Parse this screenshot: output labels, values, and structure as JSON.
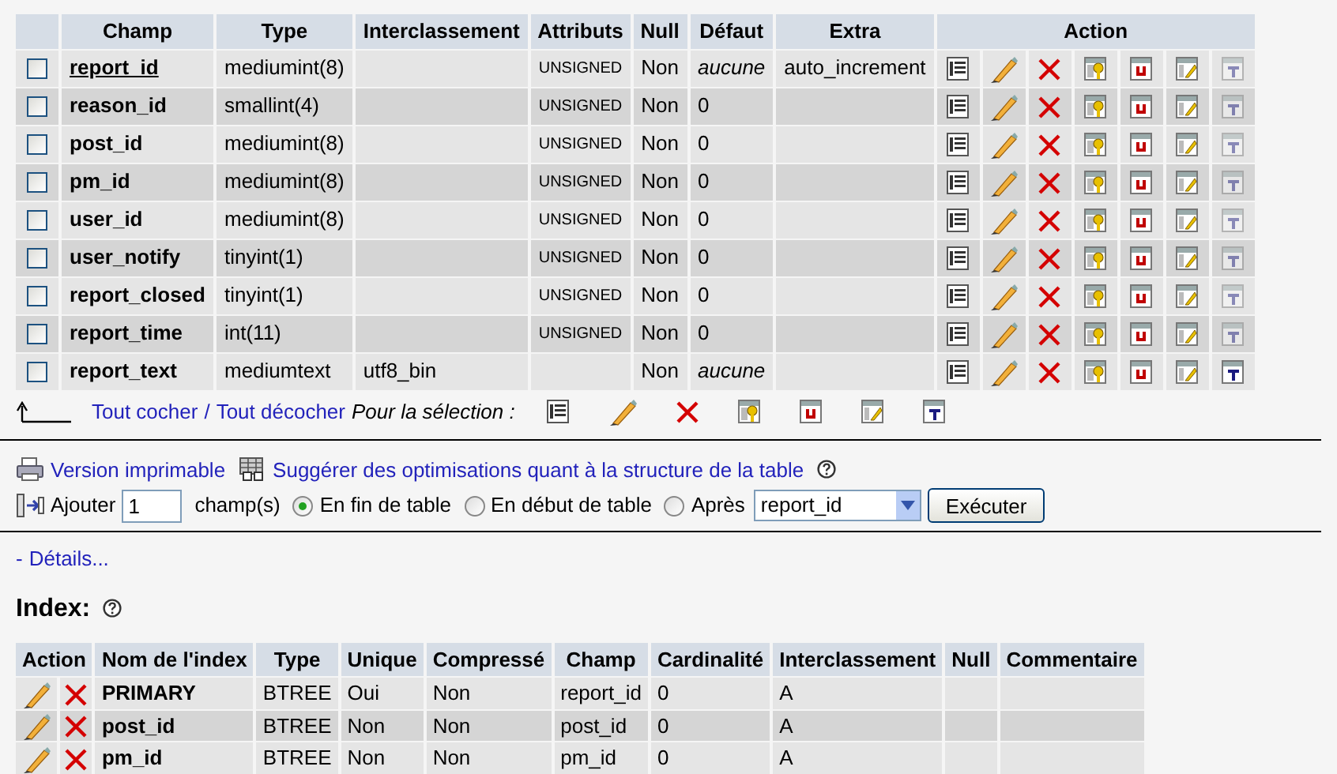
{
  "fields_table": {
    "columns": [
      "Champ",
      "Type",
      "Interclassement",
      "Attributs",
      "Null",
      "Défaut",
      "Extra",
      "Action"
    ],
    "rows": [
      {
        "checked": false,
        "name": "report_id",
        "primary": true,
        "type": "mediumint(8)",
        "attributes": "UNSIGNED",
        "null": "Non",
        "default": "aucune",
        "default_none": true,
        "extra": "auto_increment",
        "fulltext_available": false
      },
      {
        "checked": false,
        "name": "reason_id",
        "primary": false,
        "type": "smallint(4)",
        "attributes": "UNSIGNED",
        "null": "Non",
        "default": "0",
        "default_none": false,
        "fulltext_available": false
      },
      {
        "checked": false,
        "name": "post_id",
        "primary": false,
        "type": "mediumint(8)",
        "attributes": "UNSIGNED",
        "null": "Non",
        "default": "0",
        "default_none": false,
        "fulltext_available": false
      },
      {
        "checked": false,
        "name": "pm_id",
        "primary": false,
        "type": "mediumint(8)",
        "attributes": "UNSIGNED",
        "null": "Non",
        "default": "0",
        "default_none": false,
        "fulltext_available": false
      },
      {
        "checked": false,
        "name": "user_id",
        "primary": false,
        "type": "mediumint(8)",
        "attributes": "UNSIGNED",
        "null": "Non",
        "default": "0",
        "default_none": false,
        "fulltext_available": false
      },
      {
        "checked": false,
        "name": "user_notify",
        "primary": false,
        "type": "tinyint(1)",
        "attributes": "UNSIGNED",
        "null": "Non",
        "default": "0",
        "default_none": false,
        "fulltext_available": false
      },
      {
        "checked": false,
        "name": "report_closed",
        "primary": false,
        "type": "tinyint(1)",
        "attributes": "UNSIGNED",
        "null": "Non",
        "default": "0",
        "default_none": false,
        "fulltext_available": false
      },
      {
        "checked": false,
        "name": "report_time",
        "primary": false,
        "type": "int(11)",
        "attributes": "UNSIGNED",
        "null": "Non",
        "default": "0",
        "default_none": false,
        "fulltext_available": false
      },
      {
        "checked": false,
        "name": "report_text",
        "primary": false,
        "type": "mediumtext",
        "collation": "utf8_bin",
        "null": "Non",
        "default": "aucune",
        "default_none": true,
        "fulltext_available": true
      }
    ]
  },
  "selection_bar": {
    "check_all": "Tout cocher",
    "separator": "/",
    "uncheck_all": "Tout décocher",
    "label": "Pour la sélection :"
  },
  "links": [
    {
      "kind": "print",
      "label": "Version imprimable"
    },
    {
      "kind": "suggest",
      "label": "Suggérer des optimisations quant à la structure de la table"
    }
  ],
  "add_fields": {
    "label": "Ajouter",
    "count": "1",
    "unit": "champ(s)",
    "positions": [
      {
        "label": "En fin de table",
        "selected": true
      },
      {
        "label": "En début de table",
        "selected": false
      },
      {
        "label": "Après",
        "selected": false
      }
    ],
    "after_field": "report_id",
    "button": "Exécuter"
  },
  "details": {
    "prefix": "-",
    "link": "Détails..."
  },
  "index_section": {
    "title": "Index:",
    "columns": [
      "Action",
      "Nom de l'index",
      "Type",
      "Unique",
      "Compressé",
      "Champ",
      "Cardinalité",
      "Interclassement",
      "Null",
      "Commentaire"
    ],
    "rows": [
      {
        "name": "PRIMARY",
        "type": "BTREE",
        "unique": "Oui",
        "packed": "Non",
        "field": "report_id",
        "cardinality": "0",
        "collation": "A"
      },
      {
        "name": "post_id",
        "type": "BTREE",
        "unique": "Non",
        "packed": "Non",
        "field": "post_id",
        "cardinality": "0",
        "collation": "A"
      },
      {
        "name": "pm_id",
        "type": "BTREE",
        "unique": "Non",
        "packed": "Non",
        "field": "pm_id",
        "cardinality": "0",
        "collation": "A"
      }
    ]
  }
}
